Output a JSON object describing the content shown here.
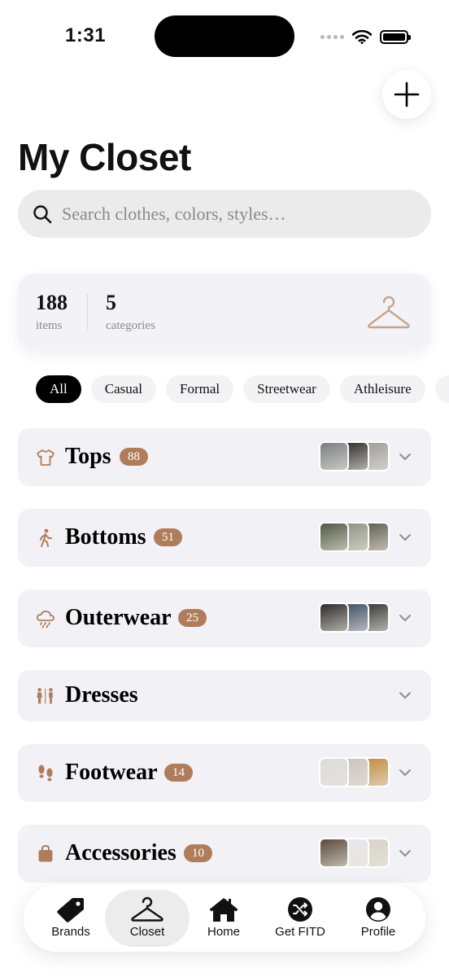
{
  "status_bar": {
    "time": "1:31"
  },
  "header": {
    "title": "My Closet",
    "add_icon": "plus-icon"
  },
  "search": {
    "placeholder": "Search clothes, colors, styles…",
    "icon": "search-icon"
  },
  "stats": {
    "items_count": "188",
    "items_label": "items",
    "categories_count": "5",
    "categories_label": "categories",
    "icon": "hanger-icon"
  },
  "filters": [
    "All",
    "Casual",
    "Formal",
    "Streetwear",
    "Athleisure"
  ],
  "filters_selected": "All",
  "categories": [
    {
      "name": "Tops",
      "count": "88",
      "icon": "tshirt-icon",
      "thumbs": [
        "#7a7f82",
        "#2a2a2a",
        "#9a9a9a"
      ]
    },
    {
      "name": "Bottoms",
      "count": "51",
      "icon": "walking-figure-icon",
      "thumbs": [
        "#4f5a44",
        "#8a9180",
        "#5b5a4a"
      ]
    },
    {
      "name": "Outerwear",
      "count": "25",
      "icon": "cloud-rain-icon",
      "thumbs": [
        "#2b2b2b",
        "#3a4a66",
        "#333333"
      ]
    },
    {
      "name": "Dresses",
      "count": "",
      "icon": "people-icon",
      "thumbs": []
    },
    {
      "name": "Footwear",
      "count": "14",
      "icon": "footprints-icon",
      "thumbs": [
        "#dcdcdc",
        "#c9c2bd",
        "#c08a3e"
      ]
    },
    {
      "name": "Accessories",
      "count": "10",
      "icon": "bag-icon",
      "thumbs": [
        "#5a4a3a",
        "#e8e8ec",
        "#d8d2c8"
      ]
    }
  ],
  "tabs": [
    {
      "label": "Brands",
      "icon": "tag-icon"
    },
    {
      "label": "Closet",
      "icon": "hanger-icon"
    },
    {
      "label": "Home",
      "icon": "house-icon"
    },
    {
      "label": "Get FITD",
      "icon": "shuffle-icon"
    },
    {
      "label": "Profile",
      "icon": "person-circle-icon"
    }
  ],
  "colors": {
    "accent": "#b07d5c",
    "card_bg": "#f2f1f6",
    "chip_active": "#000000"
  }
}
